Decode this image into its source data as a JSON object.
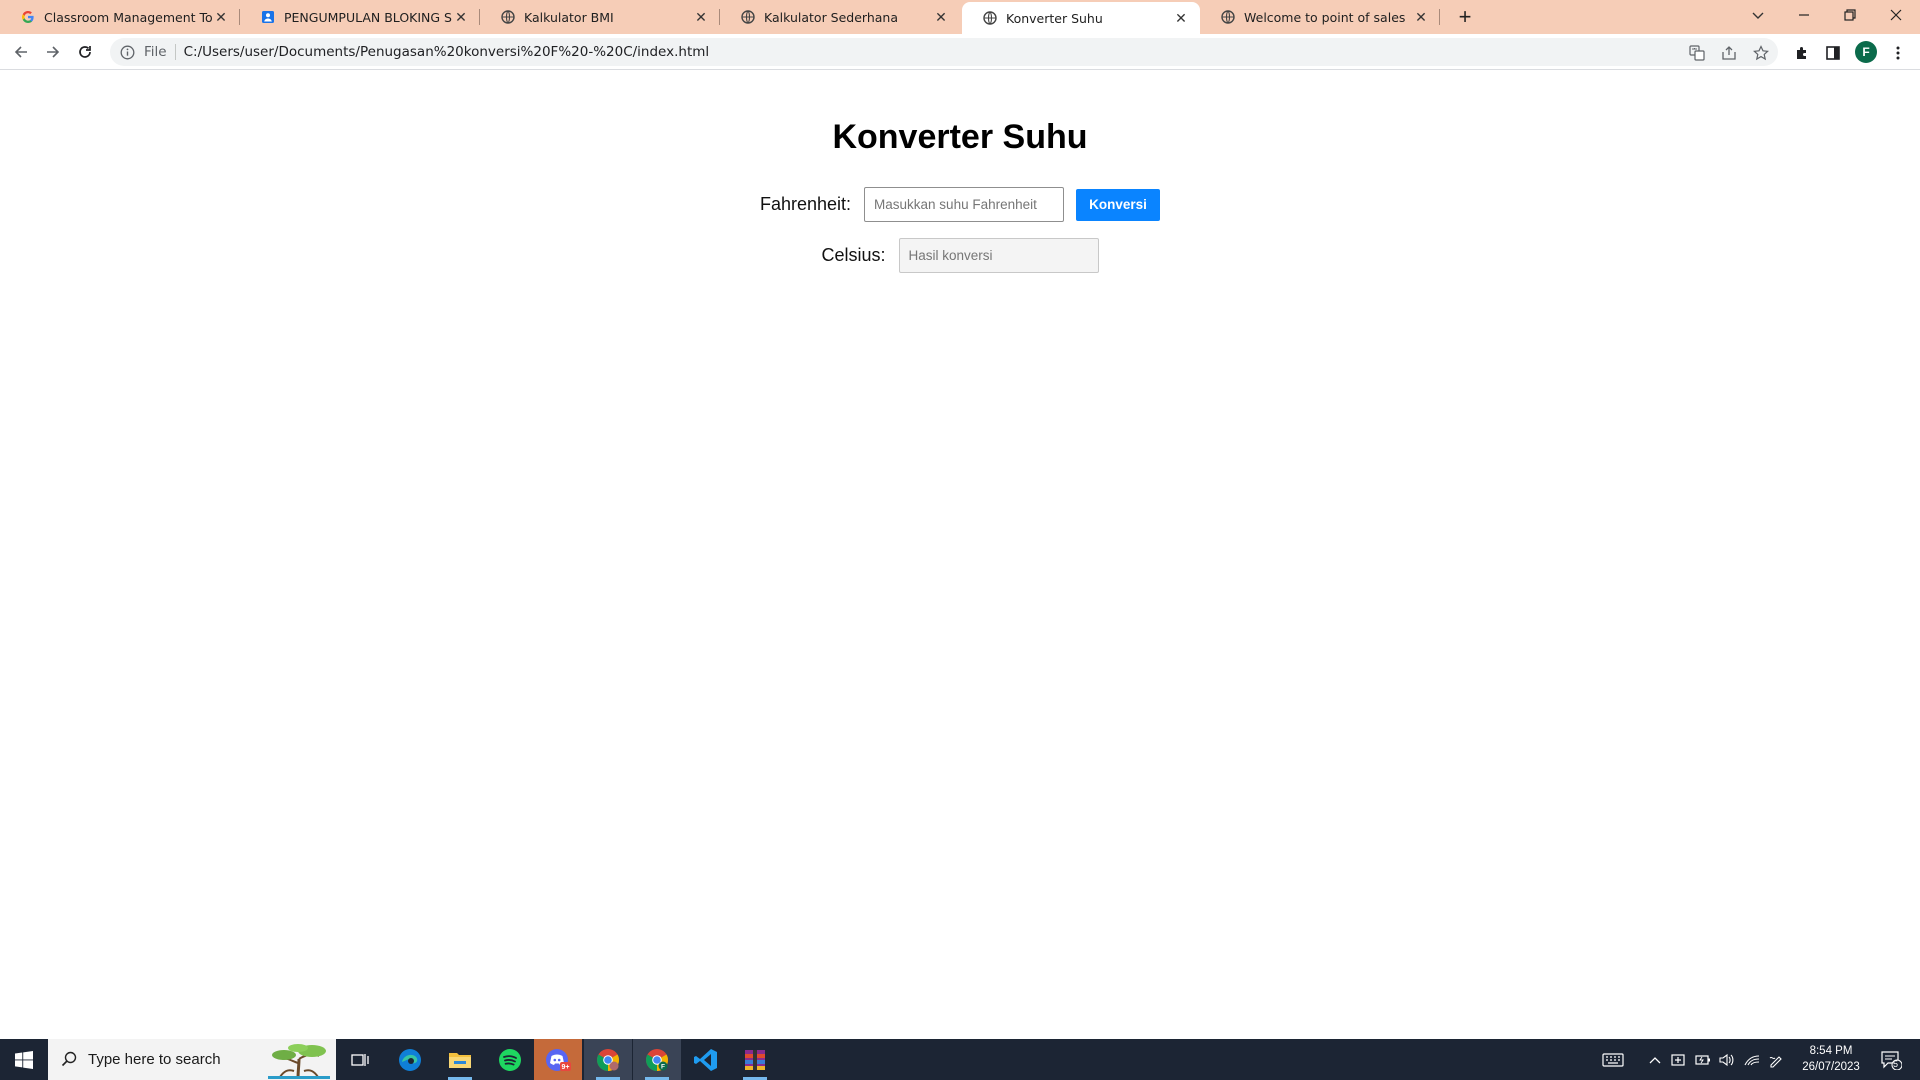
{
  "browser": {
    "tabs": [
      {
        "label": "Classroom Management Tools &",
        "icon": "google-g-icon",
        "active": false
      },
      {
        "label": "PENGUMPULAN BLOKING SELAS",
        "icon": "google-forms-icon",
        "active": false
      },
      {
        "label": "Kalkulator BMI",
        "icon": "globe-icon",
        "active": false
      },
      {
        "label": "Kalkulator Sederhana",
        "icon": "globe-icon",
        "active": false
      },
      {
        "label": "Konverter Suhu",
        "icon": "globe-icon",
        "active": true
      },
      {
        "label": "Welcome to point of sales",
        "icon": "globe-icon",
        "active": false
      }
    ],
    "omnibox": {
      "scheme": "File",
      "url": "C:/Users/user/Documents/Penugasan%20konversi%20F%20-%20C/index.html"
    },
    "profile_initial": "F",
    "colors": {
      "tabstrip": "#f6cdb7",
      "profile": "#0b6b4b"
    }
  },
  "page": {
    "title": "Konverter Suhu",
    "fahrenheit": {
      "label": "Fahrenheit:",
      "placeholder": "Masukkan suhu Fahrenheit",
      "value": ""
    },
    "convert_button": "Konversi",
    "celsius": {
      "label": "Celsius:",
      "placeholder": "Hasil konversi",
      "value": ""
    },
    "colors": {
      "button": "#0a84ff"
    }
  },
  "taskbar": {
    "search_placeholder": "Type here to search",
    "apps": [
      "task-view-icon",
      "edge-icon",
      "file-explorer-icon",
      "spotify-icon",
      "discord-icon",
      "chrome-icon",
      "chrome-profile-icon",
      "vscode-icon",
      "winrar-icon"
    ],
    "time": "8:54 PM",
    "date": "26/07/2023",
    "notification_count": "5"
  }
}
